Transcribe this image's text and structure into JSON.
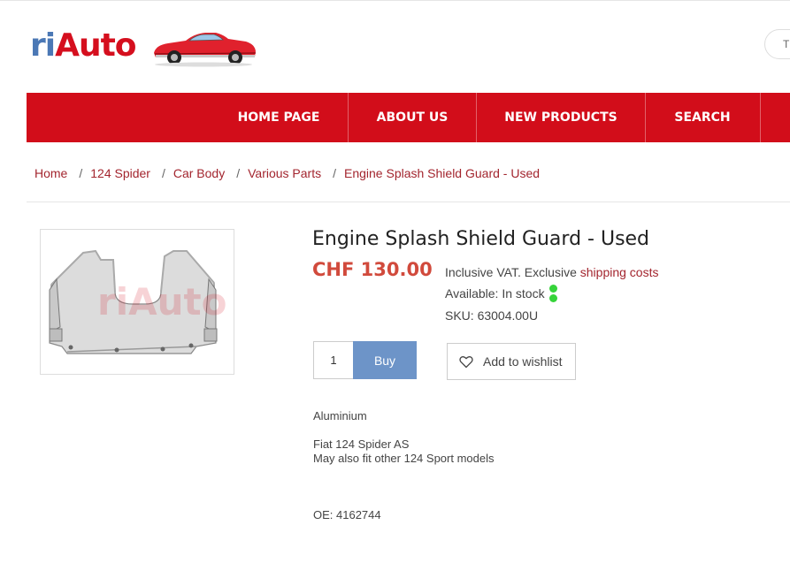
{
  "header": {
    "logo_part1": "ri",
    "logo_part2": "Auto",
    "search_placeholder_fragment": "T"
  },
  "nav": {
    "items": [
      "HOME PAGE",
      "ABOUT US",
      "NEW PRODUCTS",
      "SEARCH"
    ]
  },
  "breadcrumb": {
    "items": [
      "Home",
      "124 Spider",
      "Car Body",
      "Various Parts",
      "Engine Splash Shield Guard - Used"
    ],
    "separator": "/"
  },
  "product": {
    "title": "Engine Splash Shield Guard - Used",
    "price": "CHF 130.00",
    "vat_text": "Inclusive VAT. Exclusive ",
    "shipping_link": "shipping costs",
    "availability": "Available: In stock",
    "sku": "SKU: 63004.00U",
    "quantity": "1",
    "buy_label": "Buy",
    "wishlist_label": "Add to wishlist",
    "description": {
      "material": "Aluminium",
      "line1": "Fiat 124 Spider AS",
      "line2": "May also fit other 124 Sport models",
      "oe": "OE: 4162744"
    }
  },
  "colors": {
    "brand_red": "#d20d1a",
    "logo_blue": "#4b78b5",
    "price_red": "#d14a3c",
    "buy_blue": "#6d94c8",
    "stock_green": "#36d43a"
  }
}
